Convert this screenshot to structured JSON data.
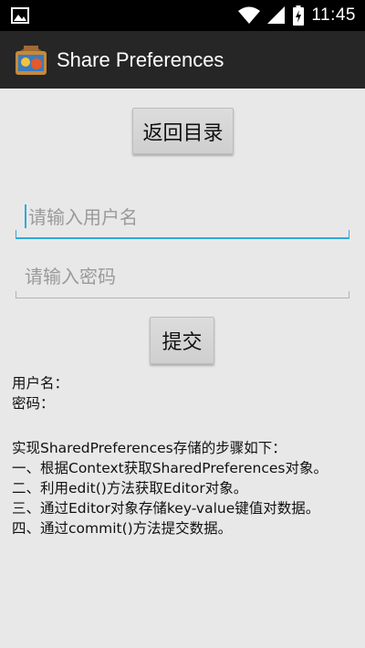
{
  "status_bar": {
    "time": "11:45",
    "icons": [
      "image-icon",
      "wifi-icon",
      "signal-icon",
      "battery-charging-icon"
    ]
  },
  "action_bar": {
    "app_icon": "app-icon",
    "title": "Share Preferences"
  },
  "buttons": {
    "back_label": "返回目录",
    "submit_label": "提交"
  },
  "inputs": {
    "username_placeholder": "请输入用户名",
    "password_placeholder": "请输入密码"
  },
  "result": {
    "username_label": "用户名：",
    "password_label": "密码："
  },
  "steps": {
    "heading": "实现SharedPreferences存储的步骤如下：",
    "items": [
      "一、根据Context获取SharedPreferences对象。",
      "二、利用edit()方法获取Editor对象。",
      "三、通过Editor对象存储key-value键值对数据。",
      "四、通过commit()方法提交数据。"
    ]
  },
  "colors": {
    "accent": "#33a9d6",
    "action_bar": "#262626",
    "background": "#e9e8e9"
  }
}
